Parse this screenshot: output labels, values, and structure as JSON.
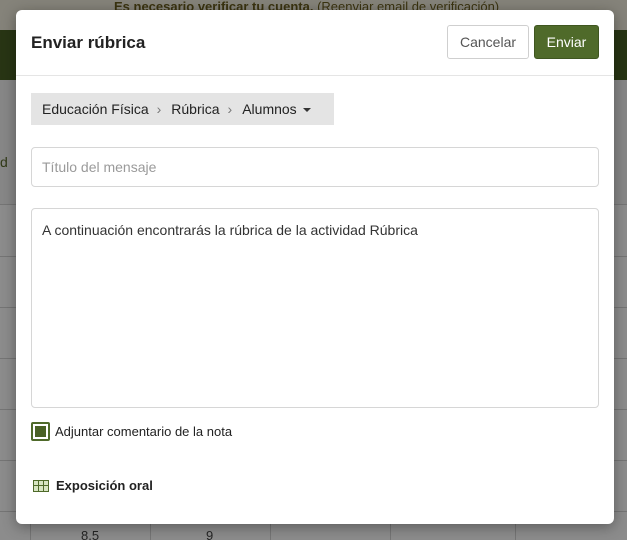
{
  "background": {
    "notice_bold": "Es necesario verificar tu cuenta.",
    "notice_link": "(Reenviar email de verificación)",
    "left_letter": "d",
    "cells": [
      "8.5",
      "9"
    ]
  },
  "modal": {
    "title": "Enviar rúbrica",
    "cancel_label": "Cancelar",
    "send_label": "Enviar",
    "breadcrumb": {
      "items": [
        "Educación Física",
        "Rúbrica",
        "Alumnos"
      ]
    },
    "subject": {
      "placeholder": "Título del mensaje",
      "value": ""
    },
    "body_value": "A continuación encontrarás la rúbrica de la actividad Rúbrica",
    "attach_comment": {
      "label": "Adjuntar comentario de la nota",
      "checked": true
    },
    "attachment": {
      "icon": "rubric-grid-icon",
      "label": "Exposición oral"
    }
  },
  "colors": {
    "accent": "#4f6a2a",
    "topbar": "#4a6125"
  }
}
